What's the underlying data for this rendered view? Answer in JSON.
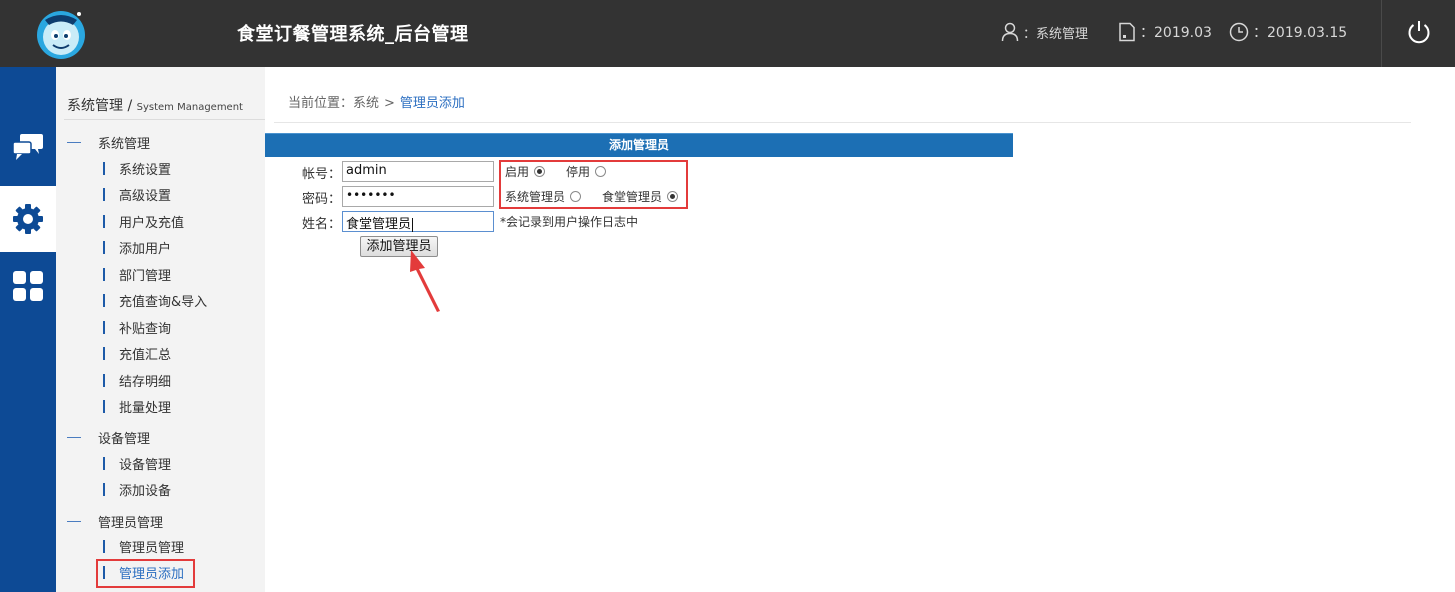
{
  "header": {
    "app_title": "食堂订餐管理系统_后台管理",
    "user_label": "：系统管理",
    "month_label": "：2019.03",
    "date_label": "：2019.03.15",
    "icons": [
      "user-icon",
      "document-icon",
      "clock-icon",
      "power-icon"
    ]
  },
  "rail": {
    "items": [
      "chat-icon",
      "gear-icon",
      "grid-icon"
    ],
    "active": "gear-icon",
    "color": "#0d4a95"
  },
  "sidebar": {
    "title": "系统管理",
    "title_sep": "/",
    "title_en": "System Management",
    "groups": [
      {
        "label": "系统管理",
        "items": [
          "系统设置",
          "高级设置",
          "用户及充值",
          "添加用户",
          "部门管理",
          "充值查询&导入",
          "补贴查询",
          "充值汇总",
          "结存明细",
          "批量处理"
        ]
      },
      {
        "label": "设备管理",
        "items": [
          "设备管理",
          "添加设备"
        ]
      },
      {
        "label": "管理员管理",
        "items": [
          "管理员管理",
          "管理员添加"
        ]
      }
    ],
    "active_item": "管理员添加"
  },
  "breadcrumb": {
    "prefix": "当前位置：系统",
    "sep": ">",
    "current": "管理员添加"
  },
  "form": {
    "title": "添加管理员",
    "account_label": "帐号：",
    "account_value": "admin",
    "password_label": "密码：",
    "password_value": "•••••••",
    "name_label": "姓名：",
    "name_value": "食堂管理员",
    "status_enable": "启用",
    "status_disable": "停用",
    "status_selected": "启用",
    "role_system": "系统管理员",
    "role_canteen": "食堂管理员",
    "role_selected": "食堂管理员",
    "note": "*会记录到用户操作日志中",
    "submit_label": "添加管理员"
  },
  "colors": {
    "accent": "#1c6fb4",
    "highlight": "#e33b3b",
    "header_bg": "#333333"
  }
}
